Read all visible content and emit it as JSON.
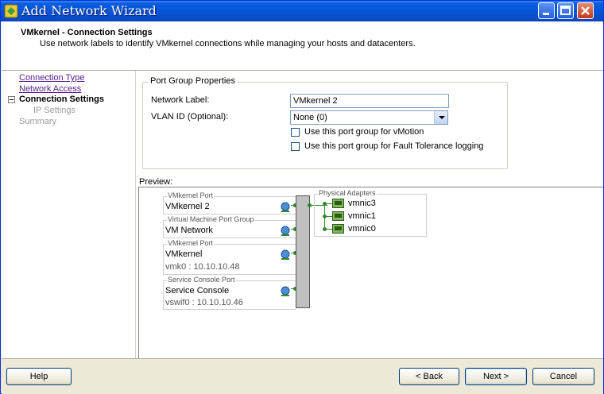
{
  "window": {
    "title": "Add Network Wizard"
  },
  "header": {
    "title": "VMkernel - Connection Settings",
    "description": "Use network labels to identify VMkernel connections while managing your hosts and datacenters."
  },
  "nav": {
    "items": [
      {
        "label": "Connection Type",
        "state": "visited"
      },
      {
        "label": "Network Access",
        "state": "visited"
      },
      {
        "label": "Connection Settings",
        "state": "current"
      },
      {
        "label": "IP Settings",
        "state": "disabled"
      },
      {
        "label": "Summary",
        "state": "disabled"
      }
    ]
  },
  "port_group": {
    "section_title": "Port Group Properties",
    "network_label_caption": "Network Label:",
    "network_label_value": "VMkernel 2",
    "vlan_caption": "VLAN ID (Optional):",
    "vlan_value": "None (0)",
    "vmotion_label": "Use this port group for vMotion",
    "vmotion_checked": false,
    "ft_label": "Use this port group for Fault Tolerance logging",
    "ft_checked": false
  },
  "preview": {
    "label": "Preview:",
    "port_groups": [
      {
        "type": "VMkernel Port",
        "name": "VMkernel 2",
        "detail": ""
      },
      {
        "type": "Virtual Machine Port Group",
        "name": "VM Network",
        "detail": ""
      },
      {
        "type": "VMkernel Port",
        "name": "VMkernel",
        "detail": "vmk0 : 10.10.10.48"
      },
      {
        "type": "Service Console Port",
        "name": "Service Console",
        "detail": "vswif0 : 10.10.10.46"
      }
    ],
    "physical_adapters_title": "Physical Adapters",
    "adapters": [
      "vmnic3",
      "vmnic1",
      "vmnic0"
    ]
  },
  "footer": {
    "help": "Help",
    "back": "< Back",
    "next": "Next >",
    "cancel": "Cancel"
  },
  "colors": {
    "title_bar": "#0654d7",
    "link": "#551a8b",
    "connector": "#2d8a2d",
    "vswitch": "#c0c0c0"
  },
  "icons": [
    "app-icon",
    "minimize-icon",
    "maximize-icon",
    "close-icon",
    "collapse-icon",
    "port-group-icon",
    "nic-icon",
    "dropdown-arrow-icon"
  ]
}
